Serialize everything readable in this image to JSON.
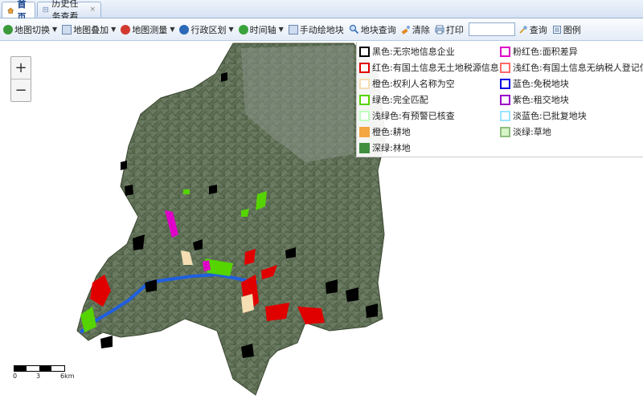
{
  "tabs": [
    {
      "label": "首页",
      "icon": "home-icon",
      "active": true
    },
    {
      "label": "历史任务查看",
      "icon": "document-icon",
      "active": false
    }
  ],
  "toolbar": {
    "items": [
      {
        "label": "地图切换",
        "icon": "globe-icon",
        "color": "#3a9a3a",
        "dropdown": true
      },
      {
        "label": "地图叠加",
        "icon": "layers-icon",
        "color": "#3d6fb5",
        "dropdown": true
      },
      {
        "label": "地图测量",
        "icon": "measure-icon",
        "color": "#d23a2f",
        "dropdown": true
      },
      {
        "label": "行政区划",
        "icon": "info-icon",
        "color": "#2c69b8",
        "dropdown": true
      },
      {
        "label": "时间轴",
        "icon": "clock-icon",
        "color": "#3aa33a",
        "dropdown": true
      },
      {
        "label": "手动绘地块",
        "icon": "draw-icon",
        "color": "#3d6fb5",
        "dropdown": false
      },
      {
        "label": "地块查询",
        "icon": "query-icon",
        "color": "#2c69b8",
        "dropdown": false
      },
      {
        "label": "清除",
        "icon": "eraser-icon",
        "color": "#e08a2a",
        "dropdown": false
      },
      {
        "label": "打印",
        "icon": "print-icon",
        "color": "#5c7fa8",
        "dropdown": false
      }
    ],
    "search_value": "",
    "query_label": "查询",
    "legend_label": "图例"
  },
  "map": {
    "zoom_in": "+",
    "zoom_out": "−",
    "scale_labels": [
      "0",
      "3",
      "6km"
    ]
  },
  "legend": {
    "left": [
      {
        "label": "黑色:无宗地信息企业",
        "color": "#000000"
      },
      {
        "label": "红色:有国土信息无土地税源信息",
        "color": "#e00000"
      },
      {
        "label": "橙色:权利人名称为空",
        "color": "#f5deb3"
      },
      {
        "label": "绿色:完全匹配",
        "color": "#55d400"
      },
      {
        "label": "浅绿色:有预警已核查",
        "color": "#bfffbf"
      },
      {
        "label": "橙色:耕地",
        "color": "#f4a640"
      },
      {
        "label": "深绿:林地",
        "color": "#3f8f3f"
      }
    ],
    "right": [
      {
        "label": "粉红色:面积差异",
        "color": "#e000c8"
      },
      {
        "label": "浅红色:有国土信息无纳税人登记信息",
        "color": "#ff6a6a"
      },
      {
        "label": "蓝色:免税地块",
        "color": "#0000e0"
      },
      {
        "label": "紫色:租交地块",
        "color": "#9a00c8"
      },
      {
        "label": "淡蓝色:已批复地块",
        "color": "#9be3ff"
      },
      {
        "label": "淡绿:草地",
        "color": "#d7f5c8"
      }
    ]
  }
}
